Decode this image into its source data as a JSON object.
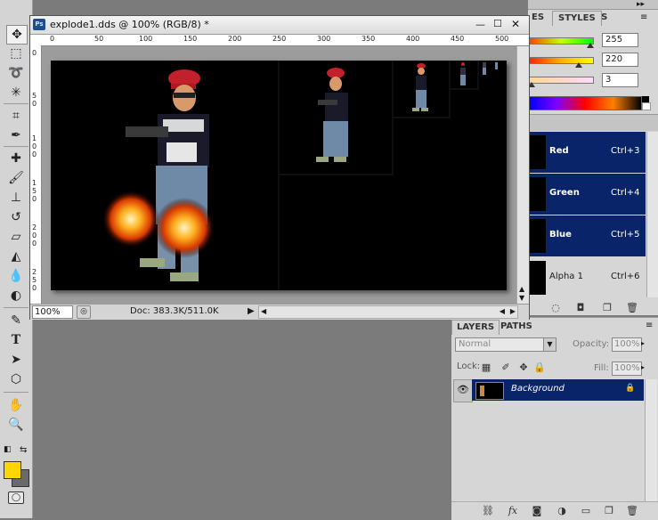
{
  "document": {
    "title": "explode1.dds @ 100% (RGB/8) *",
    "app_badge": "Ps",
    "zoom": "100%",
    "doc_info": "Doc: 383.3K/511.0K",
    "ruler_top_ticks": [
      "0",
      "50",
      "100",
      "150",
      "200",
      "250",
      "300",
      "350",
      "400",
      "450",
      "500"
    ],
    "ruler_left_ticks": [
      "0",
      "5 0",
      "1 0 0",
      "1 5 0",
      "2 0 0",
      "2 5 0"
    ]
  },
  "color_panel": {
    "tabs": [
      "ES",
      "SWATCHES",
      "STYLES"
    ],
    "values": [
      "255",
      "220",
      "3"
    ]
  },
  "channels_panel": {
    "rows": [
      {
        "name": "Red",
        "shortcut": "Ctrl+3",
        "selected": true
      },
      {
        "name": "Green",
        "shortcut": "Ctrl+4",
        "selected": true
      },
      {
        "name": "Blue",
        "shortcut": "Ctrl+5",
        "selected": true
      },
      {
        "name": "Alpha 1",
        "shortcut": "Ctrl+6",
        "selected": false
      }
    ]
  },
  "layers_panel": {
    "tabs": [
      "LAYERS",
      "PATHS"
    ],
    "blend_mode": "Normal",
    "opacity_label": "Opacity:",
    "opacity_value": "100%",
    "lock_label": "Lock:",
    "fill_label": "Fill:",
    "fill_value": "100%",
    "layers": [
      {
        "name": "Background",
        "visible": true,
        "locked": true
      }
    ]
  },
  "colors": {
    "foreground": "#ffd700",
    "background": "#6a6a6a",
    "selection": "#0a246a"
  }
}
